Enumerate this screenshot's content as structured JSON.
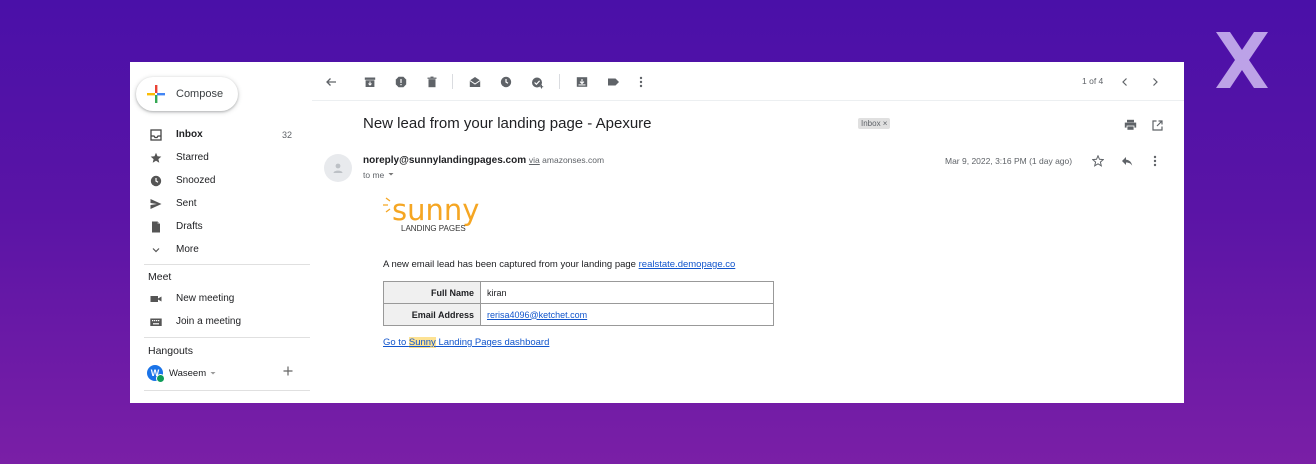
{
  "compose": {
    "label": "Compose"
  },
  "sidebar": {
    "items": [
      {
        "label": "Inbox",
        "icon": "inbox-icon",
        "count": "32",
        "active": true
      },
      {
        "label": "Starred",
        "icon": "star-icon"
      },
      {
        "label": "Snoozed",
        "icon": "clock-icon"
      },
      {
        "label": "Sent",
        "icon": "send-icon"
      },
      {
        "label": "Drafts",
        "icon": "draft-icon"
      },
      {
        "label": "More",
        "icon": "chevron-down-icon"
      }
    ],
    "meet": {
      "title": "Meet",
      "items": [
        {
          "label": "New meeting",
          "icon": "video-icon"
        },
        {
          "label": "Join a meeting",
          "icon": "keyboard-icon"
        }
      ]
    },
    "hangouts": {
      "title": "Hangouts",
      "user": {
        "initial": "W",
        "name": "Waseem",
        "status_color": "#0f9d58"
      }
    }
  },
  "toolbar": {
    "pager": "1 of 4"
  },
  "email": {
    "subject": "New lead from your landing page - Apexure",
    "tag": "Inbox ×",
    "sender": "noreply@sunnylandingpages.com",
    "via_label": "via",
    "via_domain": "amazonses.com",
    "to": "to me",
    "date": "Mar 9, 2022, 3:16 PM (1 day ago)",
    "logo": {
      "word": "sunny",
      "sub": "LANDING PAGES",
      "color": "#f5a623"
    },
    "intro": "A new email lead has been captured from your landing page",
    "page_link": "realstate.demopage.co",
    "fields": [
      {
        "key": "Full Name",
        "value": "kiran"
      },
      {
        "key": "Email Address",
        "value": "rerisa4096@ketchet.com"
      }
    ],
    "dashboard_link": {
      "pre": "Go to ",
      "highlight": "Sunny",
      "post": " Landing Pages dashboard"
    }
  },
  "colors": {
    "accent": "#1a73e8",
    "link": "#1155cc",
    "background": "#4a10a8"
  }
}
